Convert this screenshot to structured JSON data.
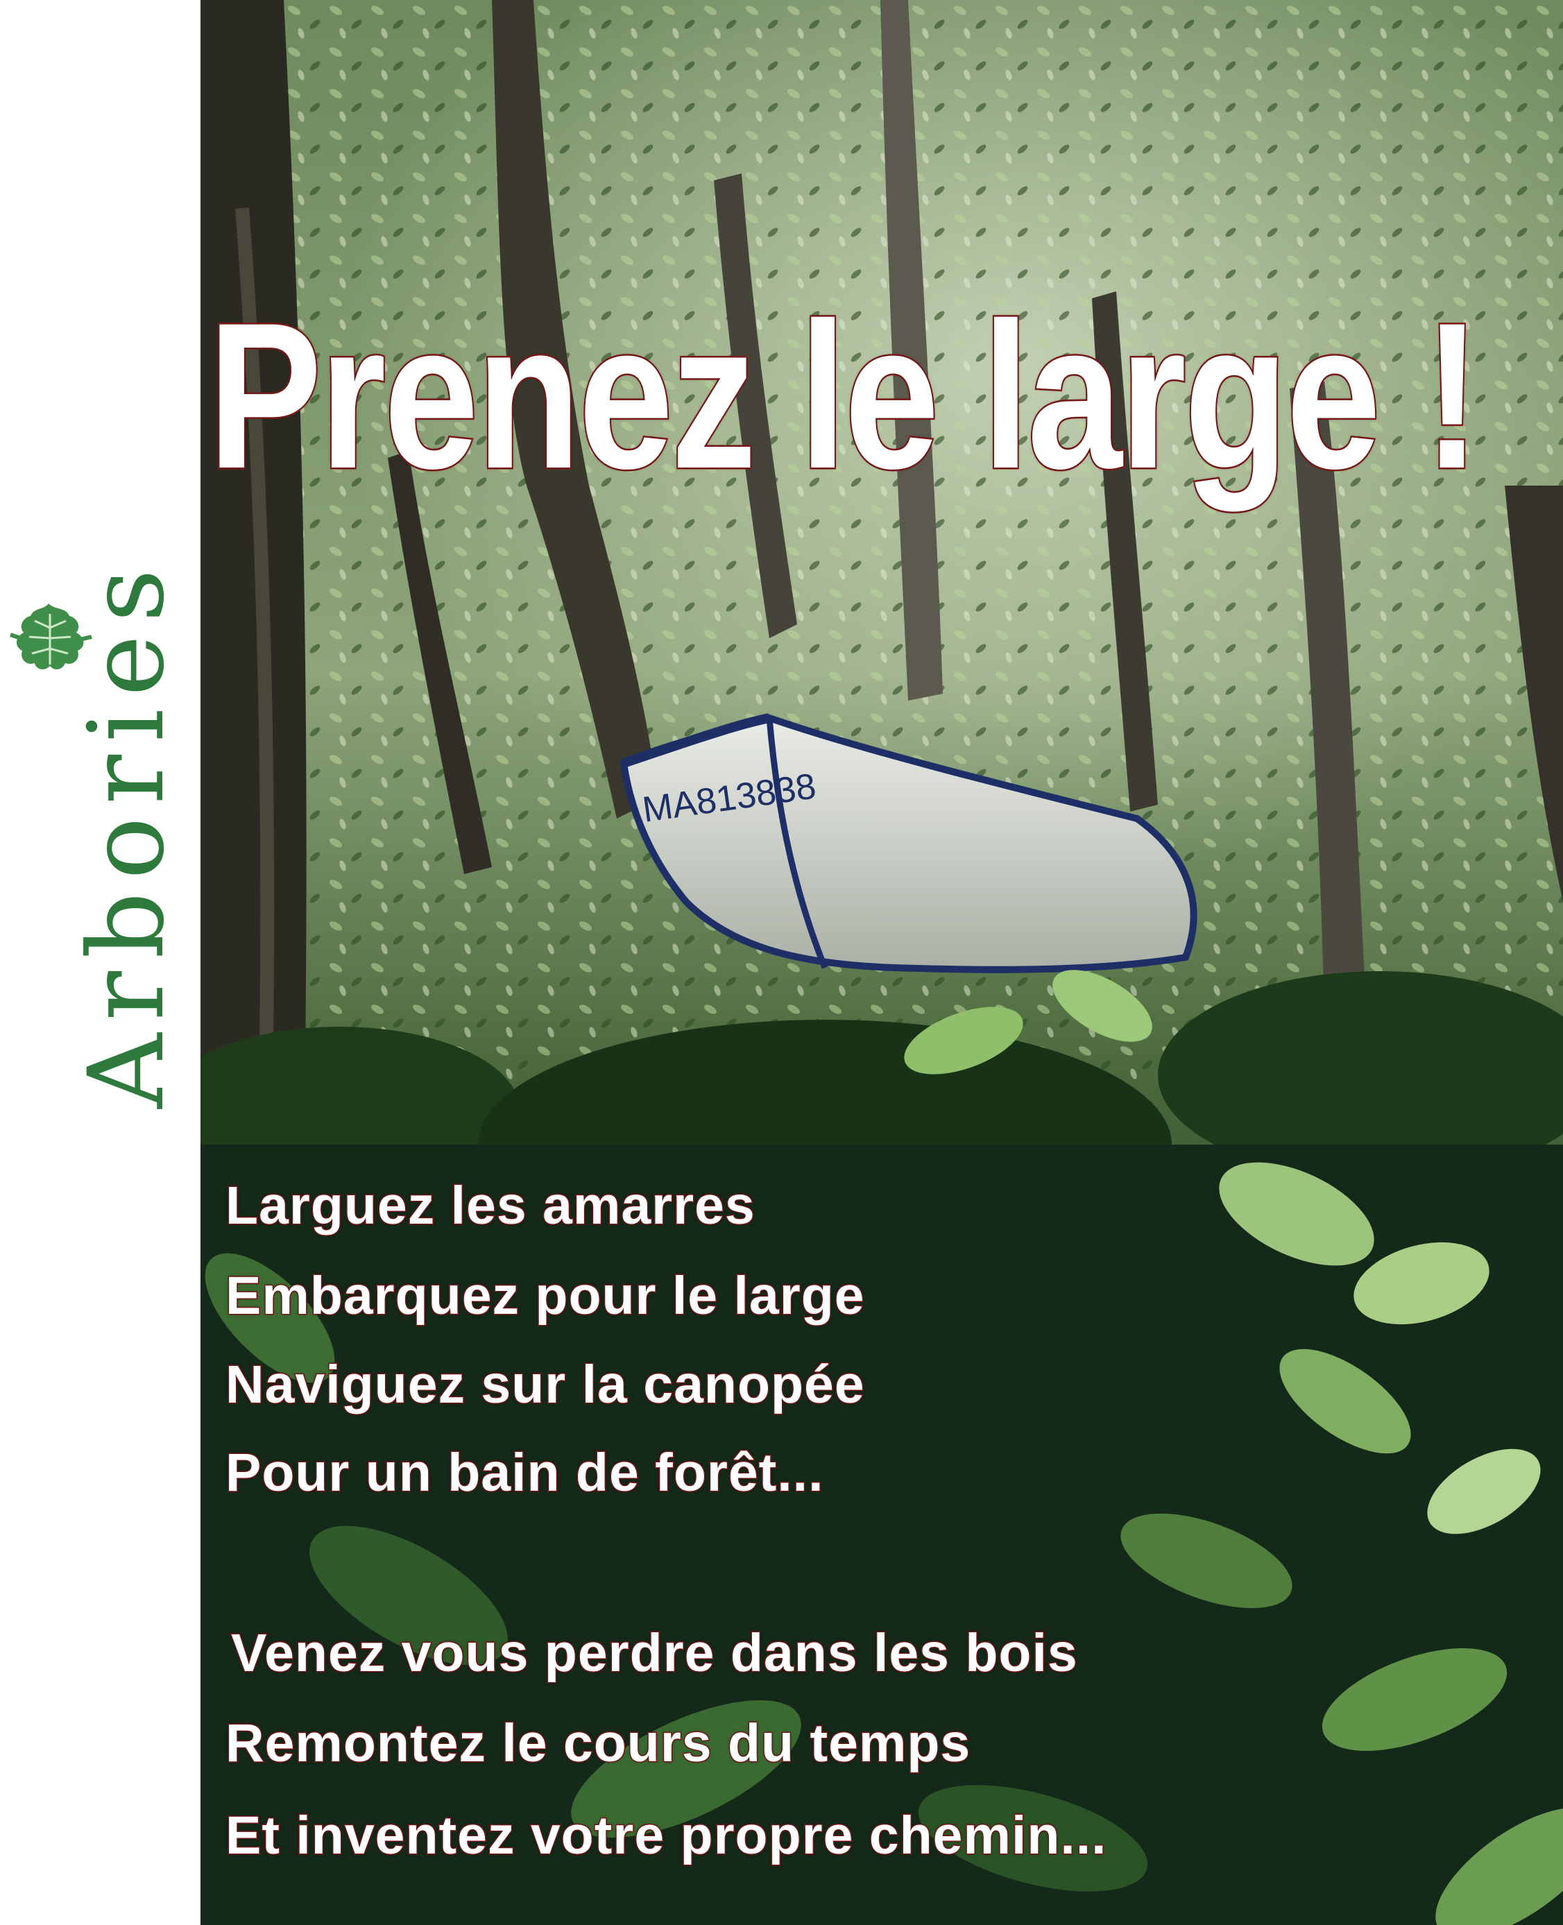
{
  "brand": {
    "name": "Arbories",
    "icon": "oak-leaf-icon",
    "color": "#2d7a3c"
  },
  "headline": "Prenez le large !",
  "boat_registration": "MA813838",
  "poem": {
    "stanza1": [
      "Larguez les amarres",
      "Embarquez pour le large",
      "Naviguez sur la canopée",
      "Pour un bain de forêt..."
    ],
    "stanza2": [
      "Venez vous perdre dans les bois",
      "Remontez le cours du temps",
      "Et inventez votre propre chemin..."
    ]
  },
  "colors": {
    "text_fill": "#ffffff",
    "text_outline": "#8a1c1c",
    "foliage_dark": "#1f3a1a",
    "foliage_light": "#8fbf6a"
  }
}
